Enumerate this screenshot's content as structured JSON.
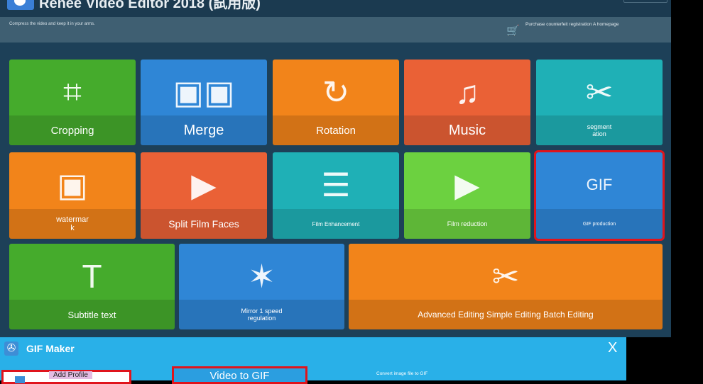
{
  "app": {
    "title": "Renee Video Editor 2018 (試用版)",
    "slogan": "Compress the video and keep it in your arms.",
    "purchase_link": "Purchase counterfeit registration A homepage"
  },
  "tiles": [
    {
      "label": "Cropping",
      "icon": "crop-icon",
      "color": "#45ab2c"
    },
    {
      "label": "Merge",
      "icon": "merge-film-icon",
      "color": "#2f86d6"
    },
    {
      "label": "Rotation",
      "icon": "rotate-icon",
      "color": "#f2841a"
    },
    {
      "label": "Music",
      "icon": "music-note-icon",
      "color": "#ea6136"
    },
    {
      "label": "segment\nation",
      "icon": "scissors-film-icon",
      "color": "#1fb0b6"
    },
    {
      "label": "watermar\nk",
      "icon": "watermark-icon",
      "color": "#f2841a"
    },
    {
      "label": "Split Film Faces",
      "icon": "split-film-icon",
      "color": "#ea6136"
    },
    {
      "label": "Film Enhancement",
      "icon": "sliders-icon",
      "color": "#1fb0b6"
    },
    {
      "label": "Film reduction",
      "icon": "compress-film-icon",
      "color": "#6cd140"
    },
    {
      "label": "GIF production",
      "icon": "gif-icon",
      "color": "#2f86d6"
    },
    {
      "label": "Subtitle text",
      "icon": "subtitle-icon",
      "color": "#45ab2c"
    },
    {
      "label": "Mirror 1 speed\nregulation",
      "icon": "magic-wand-icon",
      "color": "#2f86d6"
    },
    {
      "label": "Advanced Editing Simple Editing Batch Editing",
      "icon": "scissors-reel-icon",
      "color": "#f2841a"
    }
  ],
  "gif_maker": {
    "title": "GIF Maker",
    "close": "X",
    "add_profile": "Add Profile",
    "video_to_gif": "Video to GIF",
    "convert_image": "Convert image file to GIF"
  }
}
